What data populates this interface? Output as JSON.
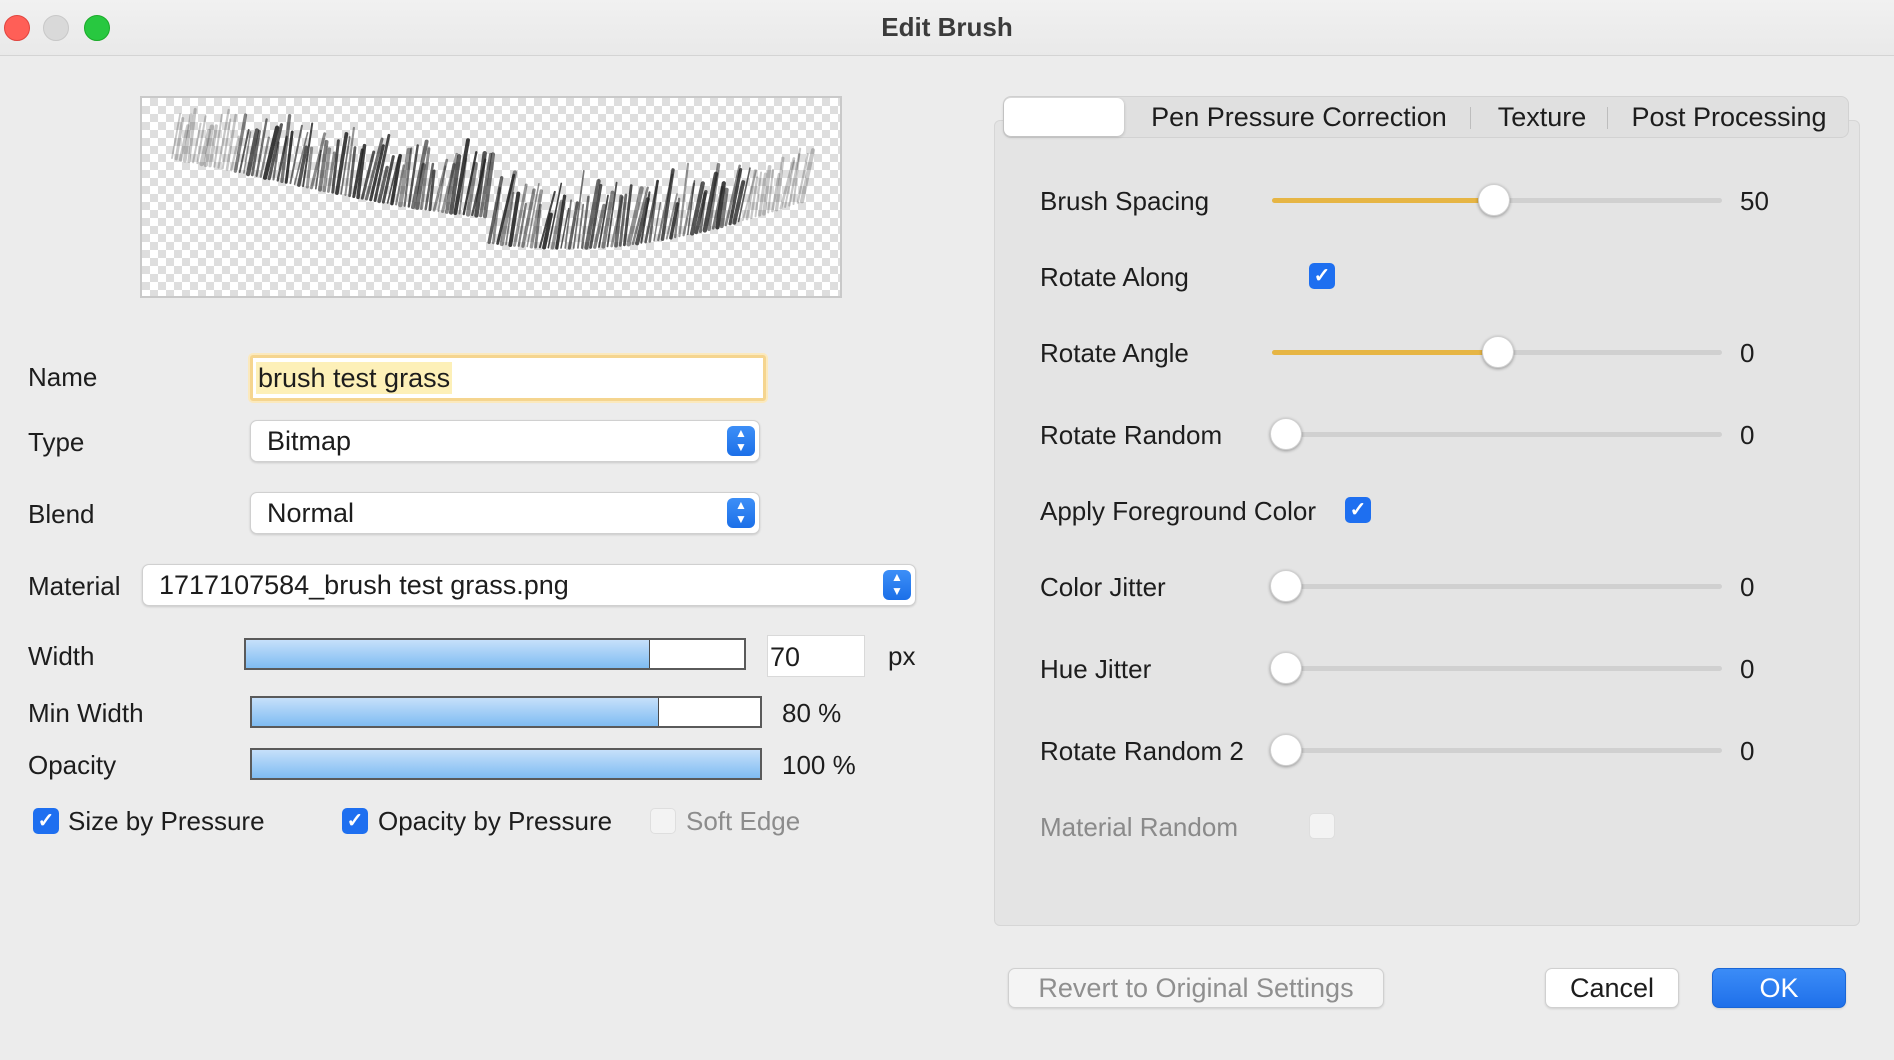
{
  "window": {
    "title": "Edit Brush"
  },
  "left": {
    "name": {
      "label": "Name",
      "value": "brush test grass"
    },
    "type": {
      "label": "Type",
      "value": "Bitmap"
    },
    "blend": {
      "label": "Blend",
      "value": "Normal"
    },
    "material": {
      "label": "Material",
      "value": "1717107584_brush test grass.png"
    },
    "width": {
      "label": "Width",
      "value": "70",
      "unit": "px",
      "fraction": 0.81
    },
    "min_width": {
      "label": "Min Width",
      "value_text": "80 %",
      "fraction": 0.8
    },
    "opacity": {
      "label": "Opacity",
      "value_text": "100 %",
      "fraction": 1.0
    },
    "checks": {
      "size_by_pressure": {
        "label": "Size by Pressure",
        "checked": true
      },
      "opacity_by_pressure": {
        "label": "Opacity by Pressure",
        "checked": true
      },
      "soft_edge": {
        "label": "Soft Edge",
        "checked": false,
        "disabled": true
      }
    }
  },
  "tabs": [
    {
      "label": "",
      "active": true
    },
    {
      "label": "Pen Pressure Correction",
      "active": false
    },
    {
      "label": "Texture",
      "active": false
    },
    {
      "label": "Post Processing",
      "active": false
    }
  ],
  "settings": {
    "brush_spacing": {
      "label": "Brush Spacing",
      "value": "50",
      "fraction": 0.49
    },
    "rotate_along": {
      "label": "Rotate Along",
      "checked": true
    },
    "rotate_angle": {
      "label": "Rotate Angle",
      "value": "0",
      "fraction": 0.5
    },
    "rotate_random": {
      "label": "Rotate Random",
      "value": "0",
      "fraction": 0
    },
    "apply_fg_color": {
      "label": "Apply Foreground Color",
      "checked": true
    },
    "color_jitter": {
      "label": "Color Jitter",
      "value": "0",
      "fraction": 0
    },
    "hue_jitter": {
      "label": "Hue Jitter",
      "value": "0",
      "fraction": 0
    },
    "rotate_random_2": {
      "label": "Rotate Random 2",
      "value": "0",
      "fraction": 0
    },
    "material_random": {
      "label": "Material Random",
      "checked": false,
      "disabled": true
    }
  },
  "buttons": {
    "revert": "Revert to Original Settings",
    "cancel": "Cancel",
    "ok": "OK"
  },
  "colors": {
    "accent": "#1e6ff0",
    "slider_fill": "#e6b544",
    "bar_fill": "#7fbcf2"
  }
}
